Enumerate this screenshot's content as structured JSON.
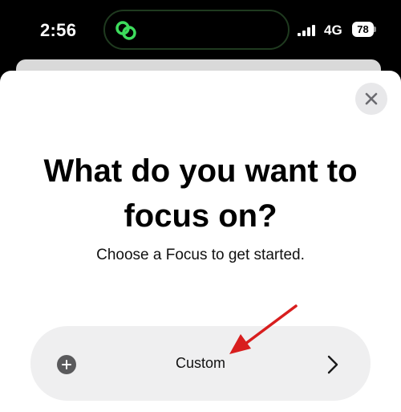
{
  "status_bar": {
    "time": "2:56",
    "network": "4G",
    "battery_level": "78"
  },
  "sheet": {
    "title_line1": "What do you want to",
    "title_line2": "focus on?",
    "subtitle": "Choose a Focus to get started.",
    "custom_label": "Custom"
  },
  "icons": {
    "island": "linked-circles-icon",
    "close": "close-icon",
    "add": "plus-circle-icon",
    "chevron": "chevron-right-icon"
  },
  "colors": {
    "island_icon": "#3ddc5c",
    "arrow": "#d81e1e",
    "row_bg": "#efeff0"
  }
}
